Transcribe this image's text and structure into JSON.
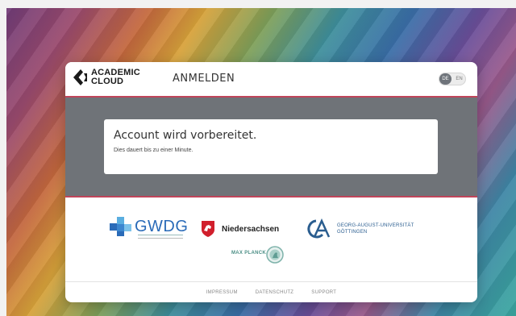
{
  "header": {
    "logo_line1": "ACADEMIC",
    "logo_line2": "CLOUD",
    "title": "ANMELDEN",
    "lang_options": [
      "DE",
      "EN"
    ],
    "lang_active": "DE"
  },
  "status": {
    "title": "Account wird vorbereitet.",
    "subtitle": "Dies dauert bis zu einer Minute."
  },
  "partners": {
    "gwdg": "GWDG",
    "niedersachsen": "Niedersachsen",
    "uni_line1": "GEORG-AUGUST-UNIVERSITÄT",
    "uni_line2": "GÖTTINGEN",
    "max_planck": "MAX PLANCK"
  },
  "footer": {
    "links": [
      "IMPRESSUM",
      "DATENSCHUTZ",
      "SUPPORT"
    ]
  },
  "colors": {
    "accent": "#c0455a",
    "status_band": "#6f7378",
    "gwdg_blue": "#2a6bb8",
    "mpg_green": "#4c8f86"
  }
}
